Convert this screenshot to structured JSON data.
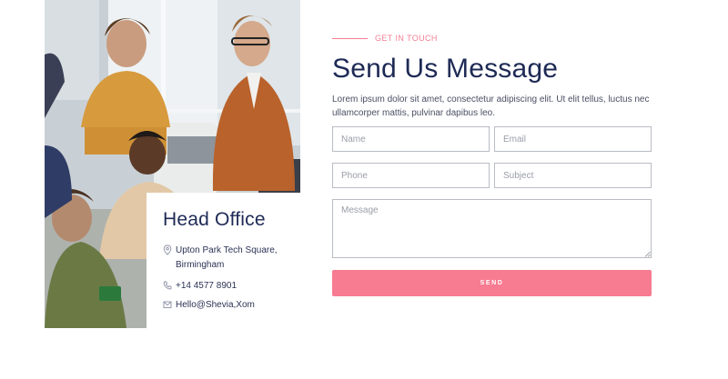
{
  "office": {
    "title": "Head Office",
    "address": "Upton Park Tech Square, Birmingham",
    "phone": "+14 4577 8901",
    "email": "Hello@Shevia,Xom"
  },
  "form": {
    "eyebrow": "GET IN TOUCH",
    "title": "Send Us Message",
    "description": "Lorem ipsum dolor sit amet, consectetur adipiscing elit. Ut elit tellus, luctus nec ullamcorper mattis, pulvinar dapibus leo.",
    "name_placeholder": "Name",
    "email_placeholder": "Email",
    "phone_placeholder": "Phone",
    "subject_placeholder": "Subject",
    "message_placeholder": "Message",
    "send_label": "SEND"
  },
  "icons": {
    "address": "map-pin-icon",
    "phone": "phone-icon",
    "email": "envelope-icon"
  },
  "colors": {
    "accent": "#f77b91",
    "heading": "#1e2a55",
    "border": "#b9bcc4"
  }
}
